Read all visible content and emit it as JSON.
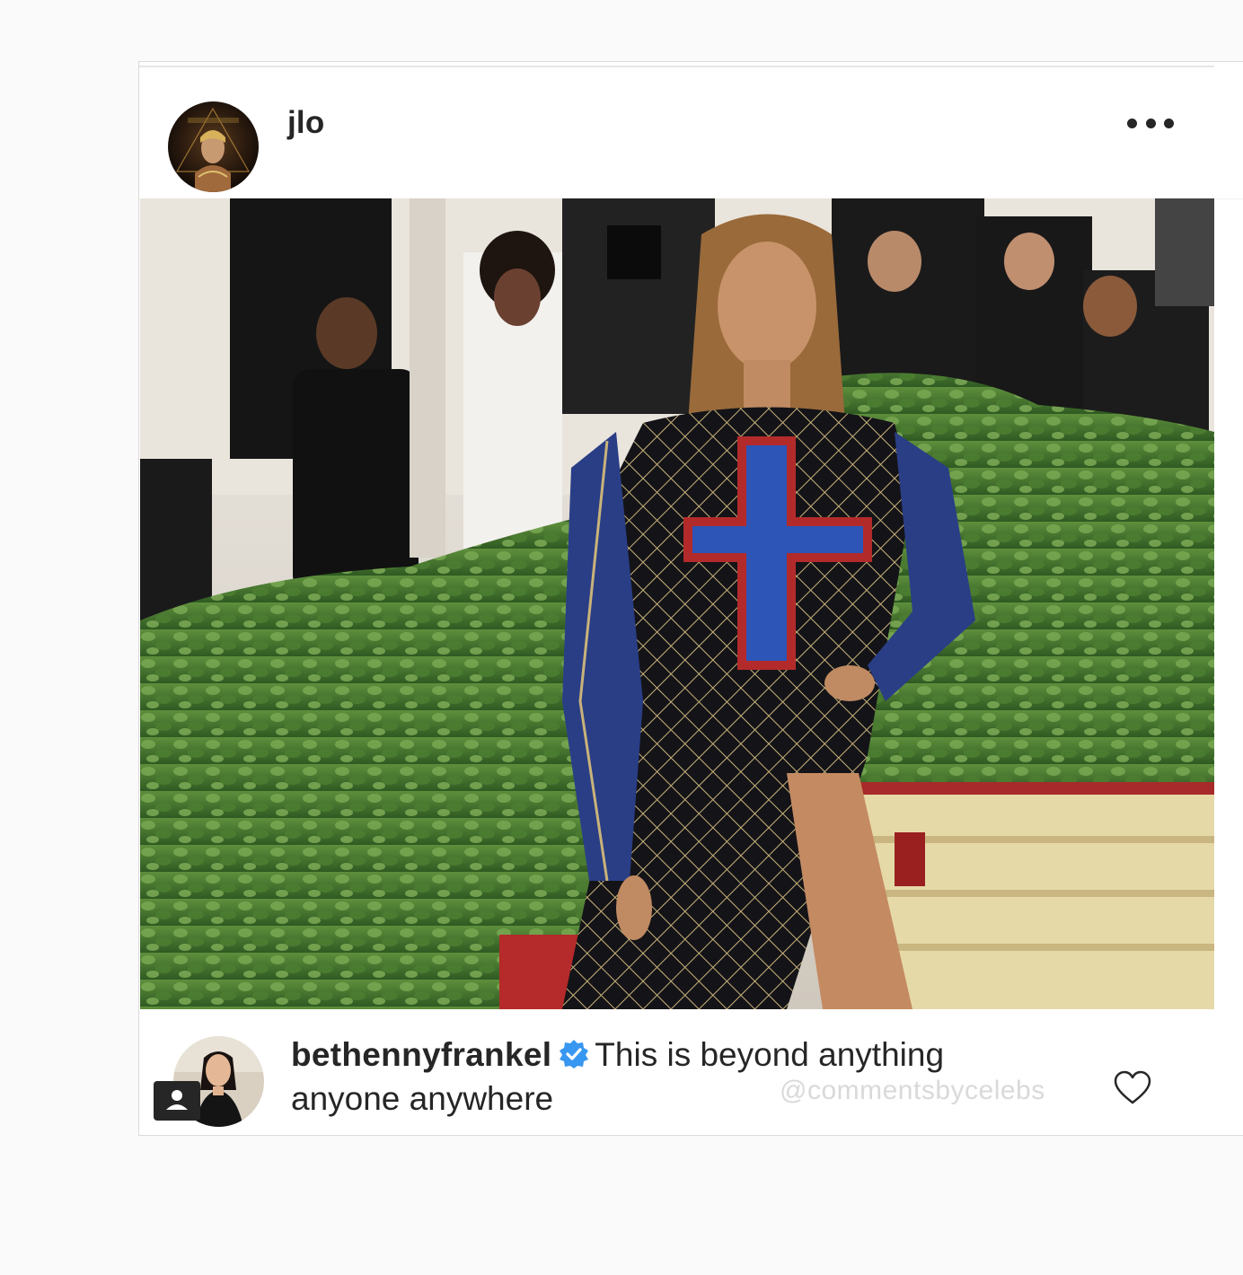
{
  "post": {
    "author": {
      "username": "jlo",
      "avatar_icon": "profile-avatar-jlo"
    },
    "menu_icon": "more-options-icon",
    "photo_icon": "post-photo"
  },
  "comment": {
    "username": "bethennyfrankel",
    "verified": true,
    "text_line1": "This is beyond anything",
    "text_line2": "anyone anywhere",
    "avatar_icon": "profile-avatar-bethennyfrankel",
    "tag_icon": "user-tag-icon",
    "like_icon": "heart-icon"
  },
  "watermark": "@commentsbycelebs",
  "colors": {
    "text": "#262626",
    "verified_badge": "#3897f0",
    "border": "#dbdbdb",
    "page_bg": "#fafafa"
  }
}
